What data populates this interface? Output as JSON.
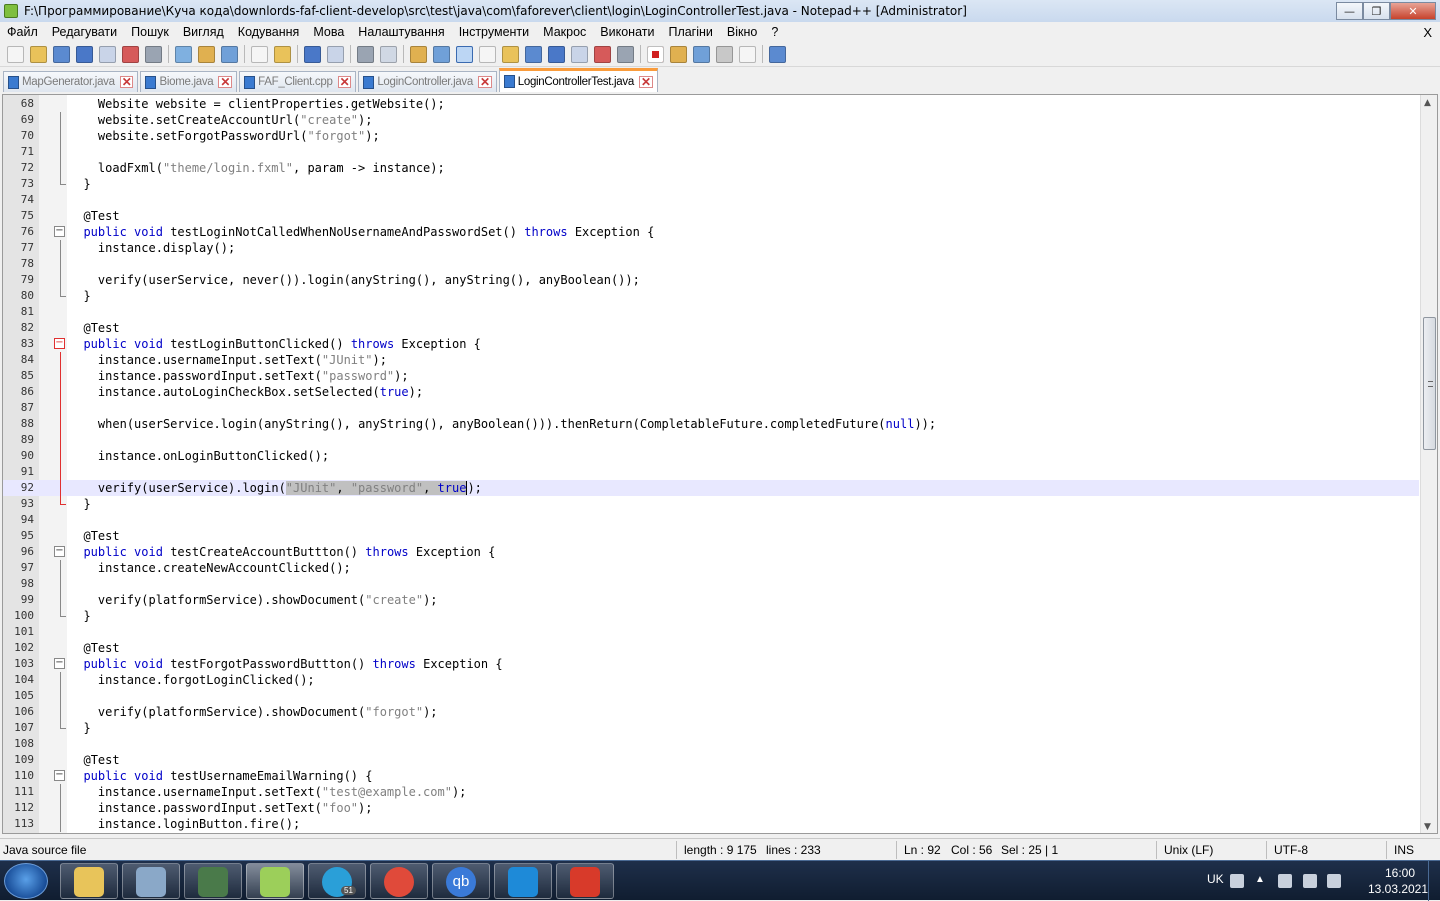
{
  "window": {
    "title": "F:\\Программирование\\Куча кода\\downlords-faf-client-develop\\src\\test\\java\\com\\faforever\\client\\login\\LoginControllerTest.java - Notepad++ [Administrator]",
    "min": "—",
    "max": "❐",
    "close": "✕"
  },
  "menu": [
    "Файл",
    "Редагувати",
    "Пошук",
    "Вигляд",
    "Кодування",
    "Мова",
    "Налаштування",
    "Інструменти",
    "Макрос",
    "Виконати",
    "Плагіни",
    "Вікно",
    "?"
  ],
  "menu_close": "X",
  "toolbar_icons": [
    "new-icon",
    "open-icon",
    "save-icon",
    "save-all-icon",
    "close-icon",
    "close-all-icon",
    "print-icon",
    "sep",
    "cut-icon",
    "copy-icon",
    "paste-icon",
    "sep",
    "undo-icon",
    "redo-icon",
    "sep",
    "find-icon",
    "replace-icon",
    "sep",
    "zoom-in-icon",
    "zoom-out-icon",
    "sep",
    "sync-v-icon",
    "sync-h-icon",
    "word-wrap-icon",
    "all-chars-icon",
    "indent-guide-icon",
    "user-lang-icon",
    "doc-map-icon",
    "function-list-icon",
    "folder-workspace-icon",
    "monitor-icon",
    "sep",
    "record-macro-icon",
    "stop-macro-icon",
    "play-macro-icon",
    "run-macro-multiple-icon",
    "save-macro-icon",
    "sep",
    "hex-icon"
  ],
  "tabs": [
    {
      "label": "MapGenerator.java",
      "active": false
    },
    {
      "label": "Biome.java",
      "active": false
    },
    {
      "label": "FAF_Client.cpp",
      "active": false
    },
    {
      "label": "LoginController.java",
      "active": false
    },
    {
      "label": "LoginControllerTest.java",
      "active": true
    }
  ],
  "tab_close": "✕",
  "editor": {
    "current_line": 92,
    "lines": [
      {
        "n": "68",
        "t": "    Website website = clientProperties.getWebsite();"
      },
      {
        "n": "69",
        "t": "    website.setCreateAccountUrl(\"create\");"
      },
      {
        "n": "70",
        "t": "    website.setForgotPasswordUrl(\"forgot\");"
      },
      {
        "n": "71",
        "t": ""
      },
      {
        "n": "72",
        "t": "    loadFxml(\"theme/login.fxml\", param -> instance);"
      },
      {
        "n": "73",
        "t": "  }",
        "fold": "end"
      },
      {
        "n": "74",
        "t": ""
      },
      {
        "n": "75",
        "t": "  @Test"
      },
      {
        "n": "76",
        "t": "  public void testLoginNotCalledWhenNoUsernameAndPasswordSet() throws Exception {",
        "fold": "start"
      },
      {
        "n": "77",
        "t": "    instance.display();"
      },
      {
        "n": "78",
        "t": ""
      },
      {
        "n": "79",
        "t": "    verify(userService, never()).login(anyString(), anyString(), anyBoolean());"
      },
      {
        "n": "80",
        "t": "  }",
        "fold": "end"
      },
      {
        "n": "81",
        "t": ""
      },
      {
        "n": "82",
        "t": "  @Test"
      },
      {
        "n": "83",
        "t": "  public void testLoginButtonClicked() throws Exception {",
        "fold": "start",
        "red": true
      },
      {
        "n": "84",
        "t": "    instance.usernameInput.setText(\"JUnit\");",
        "red": true
      },
      {
        "n": "85",
        "t": "    instance.passwordInput.setText(\"password\");",
        "red": true
      },
      {
        "n": "86",
        "t": "    instance.autoLoginCheckBox.setSelected(true);",
        "red": true
      },
      {
        "n": "87",
        "t": "",
        "red": true
      },
      {
        "n": "88",
        "t": "    when(userService.login(anyString(), anyString(), anyBoolean())).thenReturn(CompletableFuture.completedFuture(null));",
        "red": true
      },
      {
        "n": "89",
        "t": "",
        "red": true
      },
      {
        "n": "90",
        "t": "    instance.onLoginButtonClicked();",
        "red": true
      },
      {
        "n": "91",
        "t": "",
        "red": true
      },
      {
        "n": "92",
        "t": "    verify(userService).login(\"JUnit\", \"password\", true);",
        "red": true,
        "sel": [
          30,
          55
        ]
      },
      {
        "n": "93",
        "t": "  }",
        "fold": "end",
        "red": true
      },
      {
        "n": "94",
        "t": ""
      },
      {
        "n": "95",
        "t": "  @Test"
      },
      {
        "n": "96",
        "t": "  public void testCreateAccountButtton() throws Exception {",
        "fold": "start"
      },
      {
        "n": "97",
        "t": "    instance.createNewAccountClicked();"
      },
      {
        "n": "98",
        "t": ""
      },
      {
        "n": "99",
        "t": "    verify(platformService).showDocument(\"create\");"
      },
      {
        "n": "100",
        "t": "  }",
        "fold": "end"
      },
      {
        "n": "101",
        "t": ""
      },
      {
        "n": "102",
        "t": "  @Test"
      },
      {
        "n": "103",
        "t": "  public void testForgotPasswordButtton() throws Exception {",
        "fold": "start"
      },
      {
        "n": "104",
        "t": "    instance.forgotLoginClicked();"
      },
      {
        "n": "105",
        "t": ""
      },
      {
        "n": "106",
        "t": "    verify(platformService).showDocument(\"forgot\");"
      },
      {
        "n": "107",
        "t": "  }",
        "fold": "end"
      },
      {
        "n": "108",
        "t": ""
      },
      {
        "n": "109",
        "t": "  @Test"
      },
      {
        "n": "110",
        "t": "  public void testUsernameEmailWarning() {",
        "fold": "start"
      },
      {
        "n": "111",
        "t": "    instance.usernameInput.setText(\"test@example.com\");"
      },
      {
        "n": "112",
        "t": "    instance.passwordInput.setText(\"foo\");"
      },
      {
        "n": "113",
        "t": "    instance.loginButton.fire();"
      }
    ]
  },
  "status": {
    "lang": "Java source file",
    "length": "length : 9 175",
    "lines": "lines : 233",
    "ln": "Ln : 92",
    "col": "Col : 56",
    "sel": "Sel : 25 | 1",
    "eol": "Unix (LF)",
    "enc": "UTF-8",
    "mode": "INS"
  },
  "taskbar": {
    "apps": [
      {
        "name": "explorer",
        "color": "#e8c45a"
      },
      {
        "name": "control-panel",
        "color": "#8aa8c8"
      },
      {
        "name": "task-manager",
        "color": "#4a7a4a"
      },
      {
        "name": "notepad-plus-plus",
        "color": "#9ccf5a",
        "active": true
      },
      {
        "name": "telegram",
        "color": "#2a9fd8",
        "badge": "51"
      },
      {
        "name": "chrome",
        "color": "#e04a3a"
      },
      {
        "name": "qbittorrent",
        "color": "#3a7ad8",
        "text": "qb"
      },
      {
        "name": "vscode",
        "color": "#1e8ad8"
      },
      {
        "name": "windows-app",
        "color": "#d83a2a"
      }
    ],
    "lang": "UK",
    "time": "16:00",
    "date": "13.03.2021"
  },
  "colors": {
    "keyword": "#0000c8",
    "string": "#808080",
    "current_line": "#e8e8ff",
    "fold_red": "#e03030",
    "tab_accent": "#fa9c3c"
  }
}
